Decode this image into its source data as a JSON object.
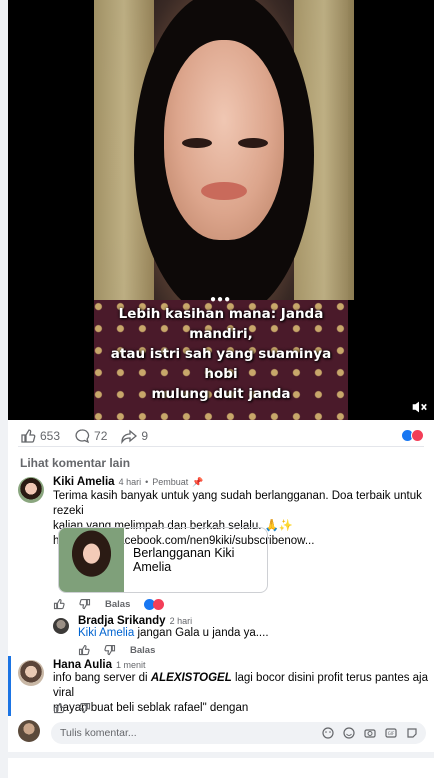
{
  "video": {
    "caption_line1": "Lebih kasihan mana: Janda mandiri,",
    "caption_line2": "atau istri sah yang suaminya hobi",
    "caption_line3": "mulung duit janda",
    "dots": "●●●"
  },
  "stats": {
    "likes": "653",
    "comments": "72",
    "shares": "9"
  },
  "see_more": "Lihat komentar lain",
  "comment1": {
    "name": "Kiki Amelia",
    "time": "4 hari",
    "badge": "Pembuat",
    "line1": "Terima kasih banyak untuk yang sudah berlangganan. Doa terbaik untuk rezeki",
    "line2": "kalian yang melimpah dan berkah selalu. 🙏✨",
    "link": "https://www.facebook.com/nen9kiki/subscribenow...",
    "card_title": "Berlangganan Kiki Amelia",
    "reply": "Balas"
  },
  "comment2": {
    "name": "Bradja Srikandy",
    "time": "2 hari",
    "mention": "Kiki Amelia",
    "text": " jangan Gala u janda ya....",
    "reply": "Balas"
  },
  "comment3": {
    "name": "Hana Aulia",
    "time": "1 menit",
    "line1_pre": "info bang server di ",
    "line1_bold": "ALEXISTOGEL",
    "line1_post": " lagi bocor disini profit terus pantes aja viral",
    "line2": "mayan buat beli seblak rafael\" dengan"
  },
  "composer": {
    "placeholder": "Tulis komentar..."
  }
}
